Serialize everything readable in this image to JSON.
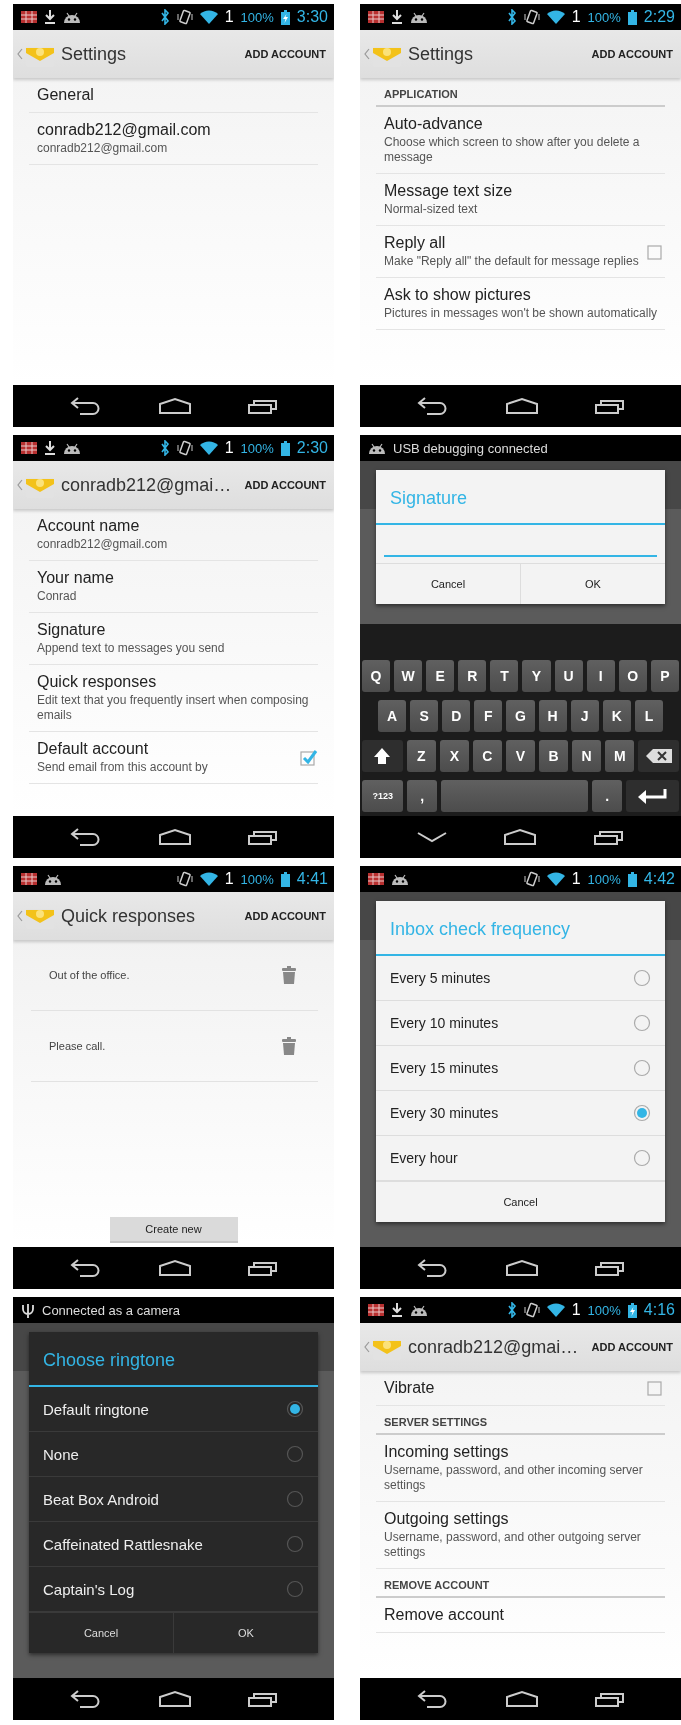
{
  "screens": [
    {
      "kind": "list",
      "status": {
        "kind": "icons",
        "left_icons": [
          {
            "kind": "grid"
          },
          {
            "kind": "download"
          },
          {
            "kind": "android"
          }
        ],
        "right_icons": [
          {
            "kind": "bluetooth"
          },
          {
            "kind": "vibrate"
          },
          {
            "kind": "wifi"
          }
        ],
        "signal": "1",
        "battery": "100%",
        "charging": true,
        "time": "3:30"
      },
      "action_bar": {
        "title": "Settings",
        "action": "ADD ACCOUNT"
      },
      "items": [
        {
          "kind": "pref",
          "title": "General"
        },
        {
          "kind": "pref",
          "title": "conradb212@gmail.com",
          "summary": "conradb212@gmail.com"
        }
      ],
      "nav": [
        {
          "kind": "back"
        },
        {
          "kind": "home"
        },
        {
          "kind": "recents"
        }
      ]
    },
    {
      "kind": "list",
      "status": {
        "kind": "icons",
        "left_icons": [
          {
            "kind": "grid"
          },
          {
            "kind": "download"
          },
          {
            "kind": "android"
          }
        ],
        "right_icons": [
          {
            "kind": "bluetooth"
          },
          {
            "kind": "vibrate"
          },
          {
            "kind": "wifi"
          }
        ],
        "signal": "1",
        "battery": "100%",
        "charging": false,
        "time": "2:29"
      },
      "action_bar": {
        "title": "Settings",
        "action": "ADD ACCOUNT"
      },
      "items": [
        {
          "kind": "header",
          "title": "APPLICATION"
        },
        {
          "kind": "pref",
          "title": "Auto-advance",
          "summary": "Choose which screen to show after you delete a message"
        },
        {
          "kind": "pref",
          "title": "Message text size",
          "summary": "Normal-sized text"
        },
        {
          "kind": "check",
          "title": "Reply all",
          "summary": "Make \"Reply all\" the default for message replies",
          "checked": false
        },
        {
          "kind": "pref",
          "title": "Ask to show pictures",
          "summary": "Pictures in messages won't be shown automatically"
        }
      ],
      "nav": [
        {
          "kind": "back"
        },
        {
          "kind": "home"
        },
        {
          "kind": "recents"
        }
      ]
    },
    {
      "kind": "list",
      "status": {
        "kind": "icons",
        "left_icons": [
          {
            "kind": "grid"
          },
          {
            "kind": "download"
          },
          {
            "kind": "android"
          }
        ],
        "right_icons": [
          {
            "kind": "bluetooth"
          },
          {
            "kind": "vibrate"
          },
          {
            "kind": "wifi"
          }
        ],
        "signal": "1",
        "battery": "100%",
        "charging": false,
        "time": "2:30"
      },
      "action_bar": {
        "title": "conradb212@gmai…",
        "action": "ADD ACCOUNT"
      },
      "items": [
        {
          "kind": "pref",
          "title": "Account name",
          "summary": "conradb212@gmail.com"
        },
        {
          "kind": "pref",
          "title": "Your name",
          "summary": "Conrad"
        },
        {
          "kind": "pref",
          "title": "Signature",
          "summary": "Append text to messages you send"
        },
        {
          "kind": "pref",
          "title": "Quick responses",
          "summary": "Edit text that you frequently insert when composing emails"
        },
        {
          "kind": "check",
          "title": "Default account",
          "summary": "Send email from this account by",
          "checked": true
        }
      ],
      "nav": [
        {
          "kind": "back"
        },
        {
          "kind": "home"
        },
        {
          "kind": "recents"
        }
      ]
    },
    {
      "kind": "input_dialog",
      "status": {
        "kind": "ticker",
        "left_icons": [
          {
            "kind": "android"
          }
        ],
        "text": "USB debugging connected"
      },
      "dialog": {
        "title": "Signature",
        "buttons": [
          "Cancel",
          "OK"
        ]
      },
      "keyboard": {
        "rows": [
          {
            "keys": [
              {
                "kind": "letter",
                "label": "Q"
              },
              {
                "kind": "letter",
                "label": "W"
              },
              {
                "kind": "letter",
                "label": "E"
              },
              {
                "kind": "letter",
                "label": "R"
              },
              {
                "kind": "letter",
                "label": "T"
              },
              {
                "kind": "letter",
                "label": "Y"
              },
              {
                "kind": "letter",
                "label": "U"
              },
              {
                "kind": "letter",
                "label": "I"
              },
              {
                "kind": "letter",
                "label": "O"
              },
              {
                "kind": "letter",
                "label": "P"
              }
            ]
          },
          {
            "keys": [
              {
                "kind": "letter",
                "label": "A"
              },
              {
                "kind": "letter",
                "label": "S"
              },
              {
                "kind": "letter",
                "label": "D"
              },
              {
                "kind": "letter",
                "label": "F"
              },
              {
                "kind": "letter",
                "label": "G"
              },
              {
                "kind": "letter",
                "label": "H"
              },
              {
                "kind": "letter",
                "label": "J"
              },
              {
                "kind": "letter",
                "label": "K"
              },
              {
                "kind": "letter",
                "label": "L"
              }
            ]
          },
          {
            "keys": [
              {
                "kind": "shift"
              },
              {
                "kind": "letter",
                "label": "Z"
              },
              {
                "kind": "letter",
                "label": "X"
              },
              {
                "kind": "letter",
                "label": "C"
              },
              {
                "kind": "letter",
                "label": "V"
              },
              {
                "kind": "letter",
                "label": "B"
              },
              {
                "kind": "letter",
                "label": "N"
              },
              {
                "kind": "letter",
                "label": "M"
              },
              {
                "kind": "delete"
              }
            ]
          },
          {
            "keys": [
              {
                "kind": "mode",
                "label": "?123"
              },
              {
                "kind": "letter",
                "label": ","
              },
              {
                "kind": "space"
              },
              {
                "kind": "letter",
                "label": "."
              },
              {
                "kind": "enter"
              }
            ]
          }
        ]
      },
      "nav": [
        {
          "kind": "hide"
        },
        {
          "kind": "home"
        },
        {
          "kind": "recents"
        }
      ]
    },
    {
      "kind": "responses",
      "status": {
        "kind": "icons",
        "left_icons": [
          {
            "kind": "grid"
          },
          {
            "kind": "android"
          }
        ],
        "right_icons": [
          {
            "kind": "vibrate"
          },
          {
            "kind": "wifi"
          }
        ],
        "signal": "1",
        "battery": "100%",
        "charging": false,
        "time": "4:41"
      },
      "action_bar": {
        "title": "Quick responses",
        "action": "ADD ACCOUNT"
      },
      "responses": [
        "Out of the office.",
        "Please call."
      ],
      "button": "Create new",
      "nav": [
        {
          "kind": "back"
        },
        {
          "kind": "home"
        },
        {
          "kind": "recents"
        }
      ]
    },
    {
      "kind": "choice_dialog_light",
      "status": {
        "kind": "icons",
        "left_icons": [
          {
            "kind": "grid"
          },
          {
            "kind": "android"
          }
        ],
        "right_icons": [
          {
            "kind": "vibrate"
          },
          {
            "kind": "wifi"
          }
        ],
        "signal": "1",
        "battery": "100%",
        "charging": false,
        "time": "4:42"
      },
      "dialog": {
        "title": "Inbox check frequency",
        "options": [
          {
            "label": "Every 5 minutes",
            "selected": false
          },
          {
            "label": "Every 10 minutes",
            "selected": false
          },
          {
            "label": "Every 15 minutes",
            "selected": false
          },
          {
            "label": "Every 30 minutes",
            "selected": true
          },
          {
            "label": "Every hour",
            "selected": false
          }
        ],
        "buttons": [
          "Cancel"
        ]
      },
      "nav": [
        {
          "kind": "back"
        },
        {
          "kind": "home"
        },
        {
          "kind": "recents"
        }
      ]
    },
    {
      "kind": "choice_dialog_dark",
      "status": {
        "kind": "ticker",
        "left_icons": [
          {
            "kind": "usb"
          }
        ],
        "text": "Connected as a camera"
      },
      "dialog": {
        "title": "Choose ringtone",
        "options": [
          {
            "label": "Default ringtone",
            "selected": true
          },
          {
            "label": "None",
            "selected": false
          },
          {
            "label": "Beat Box Android",
            "selected": false
          },
          {
            "label": "Caffeinated Rattlesnake",
            "selected": false
          },
          {
            "label": "Captain's Log",
            "selected": false
          }
        ],
        "buttons": [
          "Cancel",
          "OK"
        ]
      },
      "nav": [
        {
          "kind": "back"
        },
        {
          "kind": "home"
        },
        {
          "kind": "recents"
        }
      ]
    },
    {
      "kind": "list",
      "status": {
        "kind": "icons",
        "left_icons": [
          {
            "kind": "grid"
          },
          {
            "kind": "download"
          },
          {
            "kind": "android"
          }
        ],
        "right_icons": [
          {
            "kind": "bluetooth"
          },
          {
            "kind": "vibrate"
          },
          {
            "kind": "wifi"
          }
        ],
        "signal": "1",
        "battery": "100%",
        "charging": true,
        "time": "4:16"
      },
      "action_bar": {
        "title": "conradb212@gmai…",
        "action": "ADD ACCOUNT"
      },
      "items": [
        {
          "kind": "check",
          "title": "Vibrate",
          "checked": false
        },
        {
          "kind": "header",
          "title": "SERVER SETTINGS"
        },
        {
          "kind": "pref",
          "title": "Incoming settings",
          "summary": "Username, password, and other incoming server settings"
        },
        {
          "kind": "pref",
          "title": "Outgoing settings",
          "summary": "Username, password, and other outgoing server settings"
        },
        {
          "kind": "header",
          "title": "REMOVE ACCOUNT"
        },
        {
          "kind": "pref",
          "title": "Remove account"
        }
      ],
      "nav": [
        {
          "kind": "back"
        },
        {
          "kind": "home"
        },
        {
          "kind": "recents"
        }
      ]
    }
  ]
}
